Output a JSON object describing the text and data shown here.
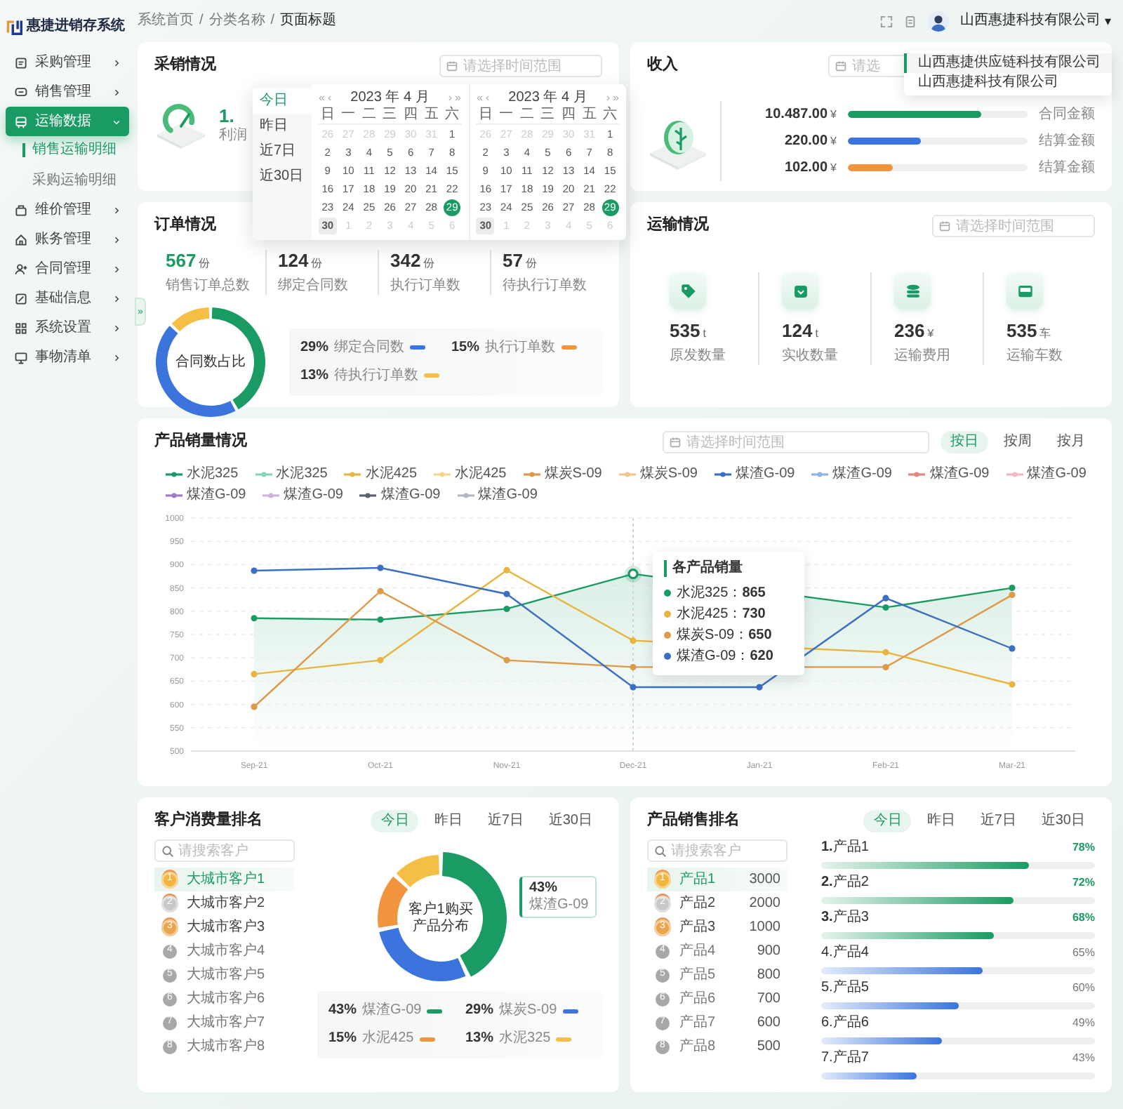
{
  "app": {
    "logo_text": "惠捷进销存系统"
  },
  "sidebar": {
    "items": [
      {
        "label": "采购管理",
        "selected": false,
        "expanded": false
      },
      {
        "label": "销售管理",
        "selected": false,
        "expanded": false
      },
      {
        "label": "运输数据",
        "selected": true,
        "expanded": true,
        "children": [
          {
            "label": "销售运输明细",
            "selected": true
          },
          {
            "label": "采购运输明细",
            "selected": false
          }
        ]
      },
      {
        "label": "维价管理",
        "selected": false,
        "expanded": false
      },
      {
        "label": "账务管理",
        "selected": false,
        "expanded": false
      },
      {
        "label": "合同管理",
        "selected": false,
        "expanded": false
      },
      {
        "label": "基础信息",
        "selected": false,
        "expanded": false
      },
      {
        "label": "系统设置",
        "selected": false,
        "expanded": false
      },
      {
        "label": "事物清单",
        "selected": false,
        "expanded": false
      }
    ]
  },
  "collapse_handle": "»",
  "breadcrumb": {
    "items": [
      "系统首页",
      "分类名称",
      "页面标题"
    ],
    "separator": "/"
  },
  "topbar": {
    "company": "山西惠捷科技有限公司",
    "caret": "▾",
    "menu": [
      {
        "label": "山西惠捷供应链科技有限公司",
        "selected": true
      },
      {
        "label": "山西惠捷科技有限公司",
        "selected": false
      }
    ]
  },
  "purchase_sales": {
    "title": "采销情况",
    "date_placeholder": "请选择时间范围",
    "value": "1.",
    "label": "利润"
  },
  "calendar": {
    "shortcuts": [
      {
        "label": "今日",
        "selected": true
      },
      {
        "label": "昨日",
        "selected": false
      },
      {
        "label": "近7日",
        "selected": false
      },
      {
        "label": "近30日",
        "selected": false
      }
    ],
    "months": [
      {
        "title": "2023 年 4 月",
        "nav": [
          {
            "label": "«",
            "kind": "prev_year"
          },
          {
            "label": "‹",
            "kind": "prev_month"
          },
          {
            "label": "›",
            "kind": "next_month"
          },
          {
            "label": "»",
            "kind": "next_year"
          }
        ],
        "weekdays": [
          "日",
          "一",
          "二",
          "三",
          "四",
          "五",
          "六"
        ],
        "days": [
          {
            "d": "26",
            "muted": true,
            "today": false,
            "selected": false
          },
          {
            "d": "27",
            "muted": true,
            "today": false,
            "selected": false
          },
          {
            "d": "28",
            "muted": true,
            "today": false,
            "selected": false
          },
          {
            "d": "29",
            "muted": true,
            "today": false,
            "selected": false
          },
          {
            "d": "30",
            "muted": true,
            "today": false,
            "selected": false
          },
          {
            "d": "31",
            "muted": true,
            "today": false,
            "selected": false
          },
          {
            "d": "1",
            "muted": false,
            "today": false,
            "selected": false
          },
          {
            "d": "2",
            "muted": false,
            "today": false,
            "selected": false
          },
          {
            "d": "3",
            "muted": false,
            "today": false,
            "selected": false
          },
          {
            "d": "4",
            "muted": false,
            "today": false,
            "selected": false
          },
          {
            "d": "5",
            "muted": false,
            "today": false,
            "selected": false
          },
          {
            "d": "6",
            "muted": false,
            "today": false,
            "selected": false
          },
          {
            "d": "7",
            "muted": false,
            "today": false,
            "selected": false
          },
          {
            "d": "8",
            "muted": false,
            "today": false,
            "selected": false
          },
          {
            "d": "9",
            "muted": false,
            "today": false,
            "selected": false
          },
          {
            "d": "10",
            "muted": false,
            "today": false,
            "selected": false
          },
          {
            "d": "11",
            "muted": false,
            "today": false,
            "selected": false
          },
          {
            "d": "12",
            "muted": false,
            "today": false,
            "selected": false
          },
          {
            "d": "13",
            "muted": false,
            "today": false,
            "selected": false
          },
          {
            "d": "14",
            "muted": false,
            "today": false,
            "selected": false
          },
          {
            "d": "15",
            "muted": false,
            "today": false,
            "selected": false
          },
          {
            "d": "16",
            "muted": false,
            "today": false,
            "selected": false
          },
          {
            "d": "17",
            "muted": false,
            "today": false,
            "selected": false
          },
          {
            "d": "18",
            "muted": false,
            "today": false,
            "selected": false
          },
          {
            "d": "19",
            "muted": false,
            "today": false,
            "selected": false
          },
          {
            "d": "20",
            "muted": false,
            "today": false,
            "selected": false
          },
          {
            "d": "21",
            "muted": false,
            "today": false,
            "selected": false
          },
          {
            "d": "22",
            "muted": false,
            "today": false,
            "selected": false
          },
          {
            "d": "23",
            "muted": false,
            "today": false,
            "selected": false
          },
          {
            "d": "24",
            "muted": false,
            "today": false,
            "selected": false
          },
          {
            "d": "25",
            "muted": false,
            "today": false,
            "selected": false
          },
          {
            "d": "26",
            "muted": false,
            "today": false,
            "selected": false
          },
          {
            "d": "27",
            "muted": false,
            "today": false,
            "selected": false
          },
          {
            "d": "28",
            "muted": false,
            "today": false,
            "selected": false
          },
          {
            "d": "29",
            "muted": false,
            "today": true,
            "selected": false
          },
          {
            "d": "30",
            "muted": false,
            "today": false,
            "selected": true
          },
          {
            "d": "1",
            "muted": true,
            "today": false,
            "selected": false
          },
          {
            "d": "2",
            "muted": true,
            "today": false,
            "selected": false
          },
          {
            "d": "3",
            "muted": true,
            "today": false,
            "selected": false
          },
          {
            "d": "4",
            "muted": true,
            "today": false,
            "selected": false
          },
          {
            "d": "5",
            "muted": true,
            "today": false,
            "selected": false
          },
          {
            "d": "6",
            "muted": true,
            "today": false,
            "selected": false
          }
        ]
      },
      {
        "title": "2023 年 4 月",
        "nav": [
          {
            "label": "«",
            "kind": "prev_year"
          },
          {
            "label": "‹",
            "kind": "prev_month"
          },
          {
            "label": "›",
            "kind": "next_month"
          },
          {
            "label": "»",
            "kind": "next_year"
          }
        ],
        "weekdays": [
          "日",
          "一",
          "二",
          "三",
          "四",
          "五",
          "六"
        ],
        "days": [
          {
            "d": "26",
            "muted": true,
            "today": false,
            "selected": false
          },
          {
            "d": "27",
            "muted": true,
            "today": false,
            "selected": false
          },
          {
            "d": "28",
            "muted": true,
            "today": false,
            "selected": false
          },
          {
            "d": "29",
            "muted": true,
            "today": false,
            "selected": false
          },
          {
            "d": "30",
            "muted": true,
            "today": false,
            "selected": false
          },
          {
            "d": "31",
            "muted": true,
            "today": false,
            "selected": false
          },
          {
            "d": "1",
            "muted": false,
            "today": false,
            "selected": false
          },
          {
            "d": "2",
            "muted": false,
            "today": false,
            "selected": false
          },
          {
            "d": "3",
            "muted": false,
            "today": false,
            "selected": false
          },
          {
            "d": "4",
            "muted": false,
            "today": false,
            "selected": false
          },
          {
            "d": "5",
            "muted": false,
            "today": false,
            "selected": false
          },
          {
            "d": "6",
            "muted": false,
            "today": false,
            "selected": false
          },
          {
            "d": "7",
            "muted": false,
            "today": false,
            "selected": false
          },
          {
            "d": "8",
            "muted": false,
            "today": false,
            "selected": false
          },
          {
            "d": "9",
            "muted": false,
            "today": false,
            "selected": false
          },
          {
            "d": "10",
            "muted": false,
            "today": false,
            "selected": false
          },
          {
            "d": "11",
            "muted": false,
            "today": false,
            "selected": false
          },
          {
            "d": "12",
            "muted": false,
            "today": false,
            "selected": false
          },
          {
            "d": "13",
            "muted": false,
            "today": false,
            "selected": false
          },
          {
            "d": "14",
            "muted": false,
            "today": false,
            "selected": false
          },
          {
            "d": "15",
            "muted": false,
            "today": false,
            "selected": false
          },
          {
            "d": "16",
            "muted": false,
            "today": false,
            "selected": false
          },
          {
            "d": "17",
            "muted": false,
            "today": false,
            "selected": false
          },
          {
            "d": "18",
            "muted": false,
            "today": false,
            "selected": false
          },
          {
            "d": "19",
            "muted": false,
            "today": false,
            "selected": false
          },
          {
            "d": "20",
            "muted": false,
            "today": false,
            "selected": false
          },
          {
            "d": "21",
            "muted": false,
            "today": false,
            "selected": false
          },
          {
            "d": "22",
            "muted": false,
            "today": false,
            "selected": false
          },
          {
            "d": "23",
            "muted": false,
            "today": false,
            "selected": false
          },
          {
            "d": "24",
            "muted": false,
            "today": false,
            "selected": false
          },
          {
            "d": "25",
            "muted": false,
            "today": false,
            "selected": false
          },
          {
            "d": "26",
            "muted": false,
            "today": false,
            "selected": false
          },
          {
            "d": "27",
            "muted": false,
            "today": false,
            "selected": false
          },
          {
            "d": "28",
            "muted": false,
            "today": false,
            "selected": false
          },
          {
            "d": "29",
            "muted": false,
            "today": true,
            "selected": false
          },
          {
            "d": "30",
            "muted": false,
            "today": false,
            "selected": true
          },
          {
            "d": "1",
            "muted": true,
            "today": false,
            "selected": false
          },
          {
            "d": "2",
            "muted": true,
            "today": false,
            "selected": false
          },
          {
            "d": "3",
            "muted": true,
            "today": false,
            "selected": false
          },
          {
            "d": "4",
            "muted": true,
            "today": false,
            "selected": false
          },
          {
            "d": "5",
            "muted": true,
            "today": false,
            "selected": false
          },
          {
            "d": "6",
            "muted": true,
            "today": false,
            "selected": false
          }
        ]
      }
    ]
  },
  "income": {
    "title": "收入",
    "date_placeholder": "请选",
    "rows": [
      {
        "amount": "10.487.00",
        "unit": "¥",
        "level": 0.74,
        "color": "#1a9b63",
        "label": "合同金额"
      },
      {
        "amount": "220.00",
        "unit": "¥",
        "level": 0.41,
        "color": "#3a74dc",
        "label": "结算金额"
      },
      {
        "amount": "102.00",
        "unit": "¥",
        "level": 0.25,
        "color": "#f0953e",
        "label": "结算金额"
      }
    ]
  },
  "orders": {
    "title": "订单情况",
    "stats": [
      {
        "value": "567",
        "unit": "份",
        "label": "销售订单总数",
        "highlight": true
      },
      {
        "value": "124",
        "unit": "份",
        "label": "绑定合同数",
        "highlight": false
      },
      {
        "value": "342",
        "unit": "份",
        "label": "执行订单数",
        "highlight": false
      },
      {
        "value": "57",
        "unit": "份",
        "label": "待执行订单数",
        "highlight": false
      }
    ],
    "donut_label": "合同数占比",
    "legend": [
      {
        "pct": "29%",
        "label": "绑定合同数",
        "color": "#3a74dc"
      },
      {
        "pct": "15%",
        "label": "执行订单数",
        "color": "#f0953e"
      },
      {
        "pct": "13%",
        "label": "待执行订单数",
        "color": "#f5bf45"
      }
    ]
  },
  "transport": {
    "title": "运输情况",
    "date_placeholder": "请选择时间范围",
    "stats": [
      {
        "value": "535",
        "unit": "t",
        "label": "原发数量"
      },
      {
        "value": "124",
        "unit": "t",
        "label": "实收数量"
      },
      {
        "value": "236",
        "unit": "¥",
        "label": "运输费用"
      },
      {
        "value": "535",
        "unit": "车",
        "label": "运输车数"
      }
    ]
  },
  "sales": {
    "title": "产品销量情况",
    "date_placeholder": "请选择时间范围",
    "periods": [
      {
        "label": "按日",
        "selected": true
      },
      {
        "label": "按周",
        "selected": false
      },
      {
        "label": "按月",
        "selected": false
      }
    ],
    "chart_data": {
      "type": "line",
      "grid": true,
      "categories": [
        "Sep-21",
        "Oct-21",
        "Nov-21",
        "Dec-21",
        "Jan-21",
        "Feb-21",
        "Mar-21"
      ],
      "series": [
        {
          "name": "水泥325",
          "color": "#1a9b63",
          "marker": true,
          "values": [
            785,
            782,
            805,
            880,
            null,
            808,
            850
          ]
        },
        {
          "name": "水泥325",
          "color": "#86d4b6",
          "marker": false,
          "values": [
            null,
            null,
            null,
            null,
            null,
            null,
            null
          ]
        },
        {
          "name": "水泥425",
          "color": "#e8b640",
          "marker": true,
          "values": [
            665,
            695,
            888,
            737,
            null,
            712,
            643
          ]
        },
        {
          "name": "水泥425",
          "color": "#f2d88a",
          "marker": false,
          "values": [
            null,
            null,
            null,
            null,
            null,
            null,
            null
          ]
        },
        {
          "name": "煤炭S-09",
          "color": "#dd9a4a",
          "marker": true,
          "values": [
            595,
            843,
            695,
            680,
            null,
            680,
            835
          ]
        },
        {
          "name": "煤炭S-09",
          "color": "#edc790",
          "marker": false,
          "values": [
            null,
            null,
            null,
            null,
            null,
            null,
            null
          ]
        },
        {
          "name": "煤渣G-09",
          "color": "#3b6fc4",
          "marker": true,
          "values": [
            887,
            893,
            837,
            637,
            637,
            828,
            720
          ]
        },
        {
          "name": "煤渣G-09",
          "color": "#8fb4e3",
          "marker": false,
          "values": [
            null,
            null,
            null,
            null,
            null,
            null,
            null
          ]
        },
        {
          "name": "煤渣G-09",
          "color": "#e08686",
          "marker": false,
          "values": [
            null,
            null,
            null,
            null,
            null,
            null,
            null
          ]
        },
        {
          "name": "煤渣G-09",
          "color": "#f2b8c6",
          "marker": false,
          "values": [
            null,
            null,
            null,
            null,
            null,
            null,
            null
          ]
        },
        {
          "name": "煤渣G-09",
          "color": "#a07cc0",
          "marker": false,
          "values": [
            null,
            null,
            null,
            null,
            null,
            null,
            null
          ]
        },
        {
          "name": "煤渣G-09",
          "color": "#cdb6de",
          "marker": false,
          "values": [
            null,
            null,
            null,
            null,
            null,
            null,
            null
          ]
        },
        {
          "name": "煤渣G-09",
          "color": "#5a6270",
          "marker": false,
          "values": [
            null,
            null,
            null,
            null,
            null,
            null,
            null
          ]
        },
        {
          "name": "煤渣G-09",
          "color": "#b5bac0",
          "marker": false,
          "values": [
            null,
            null,
            null,
            null,
            null,
            null,
            null
          ]
        }
      ],
      "ylim": [
        500,
        1000
      ],
      "yticks": [
        500,
        550,
        600,
        650,
        700,
        750,
        800,
        850,
        900,
        950,
        1000
      ]
    },
    "tooltip": {
      "title": "各产品销量",
      "items": [
        {
          "text": "水泥325：**865**",
          "color": "#1a9b63"
        },
        {
          "text": "水泥425：**730**",
          "color": "#e8b640"
        },
        {
          "text": "煤炭S-09：**650**",
          "color": "#dd9a4a"
        },
        {
          "text": "煤渣G-09：**620**",
          "color": "#3b6fc4"
        }
      ]
    }
  },
  "customers": {
    "title": "客户消费量排名",
    "periods": [
      {
        "label": "今日",
        "selected": true
      },
      {
        "label": "昨日",
        "selected": false
      },
      {
        "label": "近7日",
        "selected": false
      },
      {
        "label": "近30日",
        "selected": false
      }
    ],
    "search_placeholder": "请搜索客户",
    "list": [
      {
        "rank": "1",
        "name": "大城市客户1",
        "kind": "medal",
        "color": "#f2b540",
        "selected": true
      },
      {
        "rank": "2",
        "name": "大城市客户2",
        "kind": "medal",
        "color": "#c8c8c8",
        "selected": false
      },
      {
        "rank": "3",
        "name": "大城市客户3",
        "kind": "medal",
        "color": "#eba54c",
        "selected": false
      },
      {
        "rank": "4",
        "name": "大城市客户4",
        "kind": "plain",
        "color": "#a8a8a8",
        "selected": false
      },
      {
        "rank": "5",
        "name": "大城市客户5",
        "kind": "plain",
        "color": "#a8a8a8",
        "selected": false
      },
      {
        "rank": "6",
        "name": "大城市客户6",
        "kind": "plain",
        "color": "#a8a8a8",
        "selected": false
      },
      {
        "rank": "7",
        "name": "大城市客户7",
        "kind": "plain",
        "color": "#a8a8a8",
        "selected": false
      },
      {
        "rank": "8",
        "name": "大城市客户8",
        "kind": "plain",
        "color": "#a8a8a8",
        "selected": false
      }
    ],
    "chart_data": {
      "type": "donut",
      "categories": [
        "煤渣G-09",
        "煤炭S-09",
        "水泥425",
        "水泥325"
      ],
      "values": [
        43,
        29,
        15,
        13
      ]
    },
    "center_label": "客户1购买产品分布",
    "callout": {
      "pct": "43%",
      "label": "煤渣G-09"
    },
    "legend": [
      {
        "pct": "43%",
        "color": "#1a9b63"
      },
      {
        "pct": "29%",
        "color": "#3a74dc"
      },
      {
        "pct": "15%",
        "color": "#f0953e"
      },
      {
        "pct": "13%",
        "color": "#f5bf45"
      }
    ]
  },
  "products": {
    "title": "产品销售排名",
    "periods": [
      {
        "label": "今日",
        "selected": true
      },
      {
        "label": "昨日",
        "selected": false
      },
      {
        "label": "近7日",
        "selected": false
      },
      {
        "label": "近30日",
        "selected": false
      }
    ],
    "search_placeholder": "请搜索客户",
    "list": [
      {
        "rank": "1",
        "name": "产品1",
        "value": "3000",
        "kind": "medal",
        "color": "#f2b540",
        "selected": true
      },
      {
        "rank": "2",
        "name": "产品2",
        "value": "2000",
        "kind": "medal",
        "color": "#c8c8c8",
        "selected": false
      },
      {
        "rank": "3",
        "name": "产品3",
        "value": "1000",
        "kind": "medal",
        "color": "#eba54c",
        "selected": false
      },
      {
        "rank": "4",
        "name": "产品4",
        "value": "900",
        "kind": "plain",
        "color": "#a8a8a8",
        "selected": false
      },
      {
        "rank": "5",
        "name": "产品5",
        "value": "800",
        "kind": "plain",
        "color": "#a8a8a8",
        "selected": false
      },
      {
        "rank": "6",
        "name": "产品6",
        "value": "700",
        "kind": "plain",
        "color": "#a8a8a8",
        "selected": false
      },
      {
        "rank": "7",
        "name": "产品7",
        "value": "600",
        "kind": "plain",
        "color": "#a8a8a8",
        "selected": false
      },
      {
        "rank": "8",
        "name": "产品8",
        "value": "500",
        "kind": "plain",
        "color": "#a8a8a8",
        "selected": false
      }
    ],
    "bars": [
      {
        "label": "**1.**产品1",
        "pct": "78%",
        "level": 0.76,
        "kind": "top"
      },
      {
        "label": "**2.**产品2",
        "pct": "72%",
        "level": 0.7,
        "kind": "top"
      },
      {
        "label": "**3.**产品3",
        "pct": "68%",
        "level": 0.63,
        "kind": "top"
      },
      {
        "label": "4.产品4",
        "pct": "65%",
        "level": 0.59,
        "kind": "normal"
      },
      {
        "label": "5.产品5",
        "pct": "60%",
        "level": 0.5,
        "kind": "normal"
      },
      {
        "label": "6.产品6",
        "pct": "49%",
        "level": 0.44,
        "kind": "normal"
      },
      {
        "label": "7.产品7",
        "pct": "43%",
        "level": 0.35,
        "kind": "normal"
      }
    ]
  }
}
